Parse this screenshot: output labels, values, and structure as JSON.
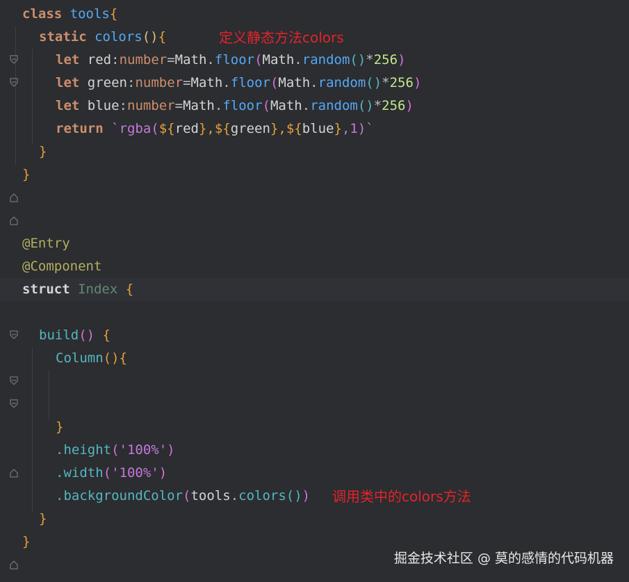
{
  "annotations": {
    "define_static": "定义静态方法colors",
    "call_method": "调用类中的colors方法"
  },
  "watermark": "掘金技术社区 @ 莫的感情的代码机器",
  "code": {
    "l1_kw": "class",
    "l1_name": "tools",
    "l1_brace": "{",
    "l2_kw": "static",
    "l2_name": "colors",
    "l2_parens": "()",
    "l2_brace": "{",
    "l3_let": "let",
    "l3_var": "red",
    "l4_let": "let",
    "l4_var": "green",
    "l5_let": "let",
    "l5_var": "blue",
    "colon": ":",
    "type_number": "number",
    "eq": "=",
    "math": "Math",
    "dot": ".",
    "floor": "floor",
    "random": "random",
    "mul": "*",
    "num256": "256",
    "lparen": "(",
    "rparen": ")",
    "empty_parens": "()",
    "l6_return": "return",
    "l6_tpl_start": "`rgba(",
    "l6_d1": "${",
    "l6_v1": "red",
    "l6_c1": "},",
    "l6_d2": "${",
    "l6_v2": "green",
    "l6_c2": "},",
    "l6_d3": "${",
    "l6_v3": "blue",
    "l6_c3": "}",
    "l6_tpl_end": ",1)`",
    "close_brace": "}",
    "entry": "@Entry",
    "component": "@Component",
    "struct_kw": "struct",
    "struct_name": "Index",
    "build": "build",
    "column": "Column",
    "height": ".height",
    "width": ".width",
    "pct": "'100%'",
    "bg": ".backgroundColor",
    "tools": "tools",
    "colors": "colors"
  }
}
